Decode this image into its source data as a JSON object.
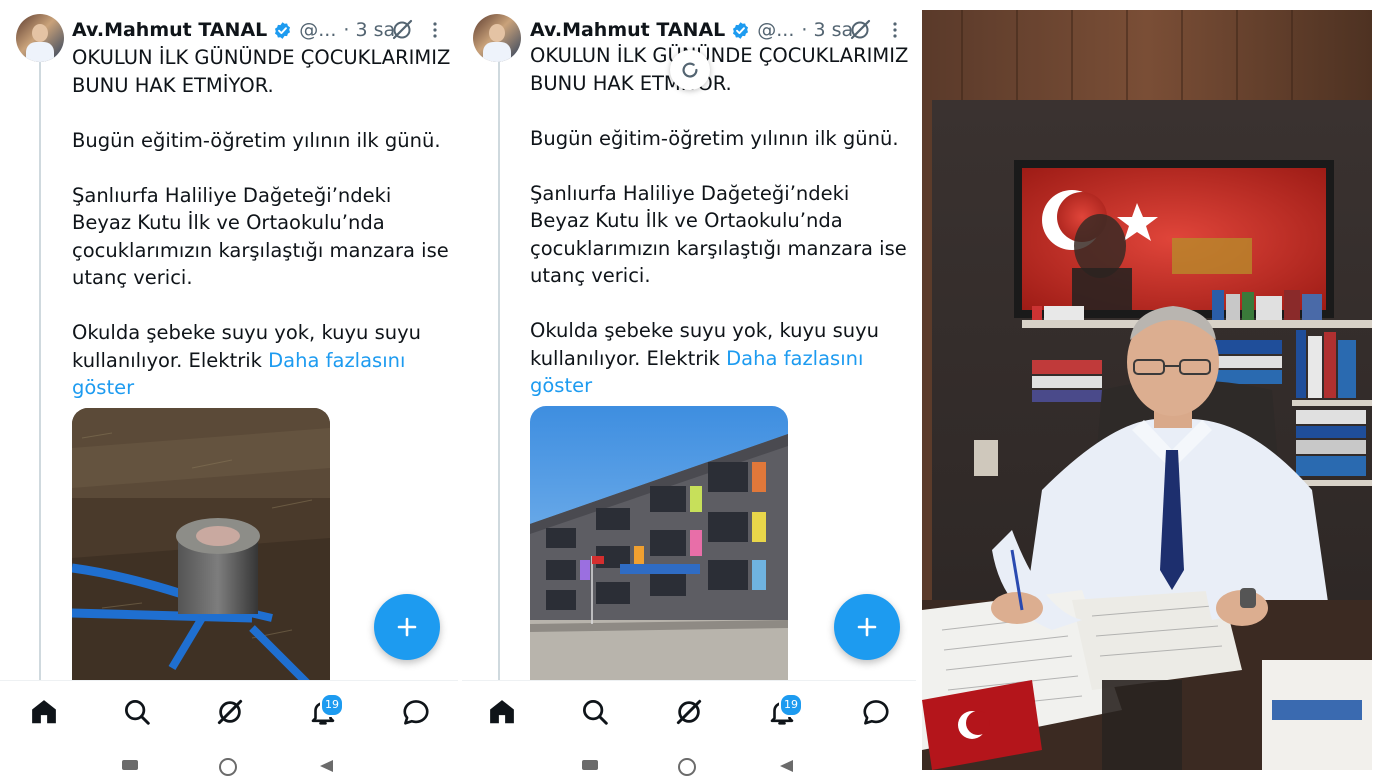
{
  "tweet": {
    "author_name": "Av.Mahmut TANAL",
    "handle": "@...",
    "time": "· 3 sa",
    "paragraphs": [
      "OKULUN İLK GÜNÜNDE ÇOCUKLARIMIZ BUNU HAK ETMİYOR.",
      "Bugün eğitim-öğretim yılının ilk günü.",
      "Şanlıurfa Haliliye Dağeteği’ndeki Beyaz Kutu İlk ve Ortaokulu’nda çocuklarımızın karşılaştığı manzara ise utanç verici.",
      "Okulda şebeke suyu yok, kuyu suyu kullanılıyor. Elektrik"
    ],
    "show_more": "Daha fazlasını göster"
  },
  "nav": {
    "items": [
      "home-icon",
      "search-icon",
      "grok-icon",
      "notifications-icon",
      "messages-icon"
    ],
    "notification_count": "19"
  },
  "fab": {
    "icon": "plus-icon"
  },
  "colors": {
    "accent": "#1d9bf0",
    "text": "#0f1419",
    "muted": "#536471"
  }
}
